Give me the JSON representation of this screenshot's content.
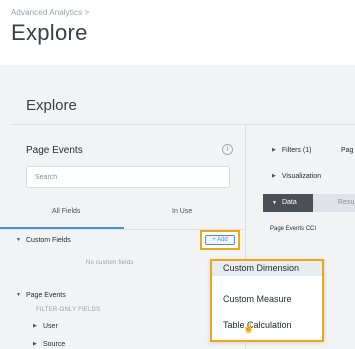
{
  "breadcrumb": "Advanced Analytics >",
  "page_title": "Explore",
  "explore_heading": "Explore",
  "model": {
    "name": "Page Events"
  },
  "search": {
    "placeholder": "Search"
  },
  "tabs": {
    "all_fields": "All Fields",
    "in_use": "In Use"
  },
  "tree": {
    "custom_fields": "Custom Fields",
    "no_custom_fields": "No custom fields",
    "page_events": "Page Events",
    "filter_only": "FILTER-ONLY FIELDS",
    "user": "User",
    "source": "Source"
  },
  "right_panel": {
    "filters": "Filters (1)",
    "page_partial": "Pag",
    "visualization": "Visualization",
    "data_tab": "Data",
    "next_tab_partial": "Resu",
    "field_chip": "Page Events CCI"
  },
  "add_button": {
    "label": "+ Add"
  },
  "dropdown": {
    "items": [
      "Custom Dimension",
      "Custom Measure",
      "Table Calculation"
    ],
    "highlighted": "Custom Dimension"
  },
  "icons": {
    "info": "info-icon",
    "caret_right": "caret-right-icon",
    "caret_down": "caret-down-icon",
    "cursor": "hand-cursor-icon"
  },
  "colors": {
    "highlight_border": "#f1a616",
    "accent_blue": "#4a8fd3",
    "panel_bg": "#f2f3f5",
    "dark_tab": "#4a5056"
  }
}
